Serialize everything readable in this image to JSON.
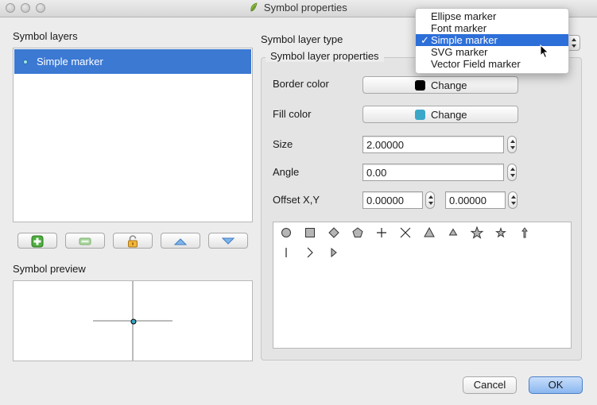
{
  "window": {
    "title": "Symbol properties"
  },
  "symbol_layers": {
    "label": "Symbol layers",
    "items": [
      {
        "label": "Simple marker"
      }
    ]
  },
  "toolbar_icons": [
    "add-icon",
    "remove-icon",
    "lock-icon",
    "move-up-icon",
    "move-down-icon"
  ],
  "symbol_preview": {
    "label": "Symbol preview"
  },
  "layer_type": {
    "label": "Symbol layer type",
    "selected": "Simple marker",
    "options": [
      "Ellipse marker",
      "Font marker",
      "Simple marker",
      "SVG marker",
      "Vector Field marker"
    ]
  },
  "props": {
    "title": "Symbol layer properties",
    "border_color": {
      "label": "Border color",
      "button": "Change",
      "color": "#000000"
    },
    "fill_color": {
      "label": "Fill color",
      "button": "Change",
      "color": "#3aa7c8"
    },
    "size": {
      "label": "Size",
      "value": "2.00000"
    },
    "angle": {
      "label": "Angle",
      "value": "0.00"
    },
    "offset": {
      "label": "Offset X,Y",
      "x": "0.00000",
      "y": "0.00000"
    }
  },
  "shapes": [
    "circle",
    "square",
    "diamond",
    "pentagon",
    "cross",
    "x",
    "triangle",
    "equilateral-triangle",
    "star",
    "regular-star",
    "arrow",
    "line",
    "arrowhead",
    "filled-arrowhead"
  ],
  "buttons": {
    "cancel": "Cancel",
    "ok": "OK"
  },
  "colors": {
    "selection": "#3b79d3",
    "menu_selection": "#2d6fd9",
    "default_button": "#9cc3f3"
  }
}
